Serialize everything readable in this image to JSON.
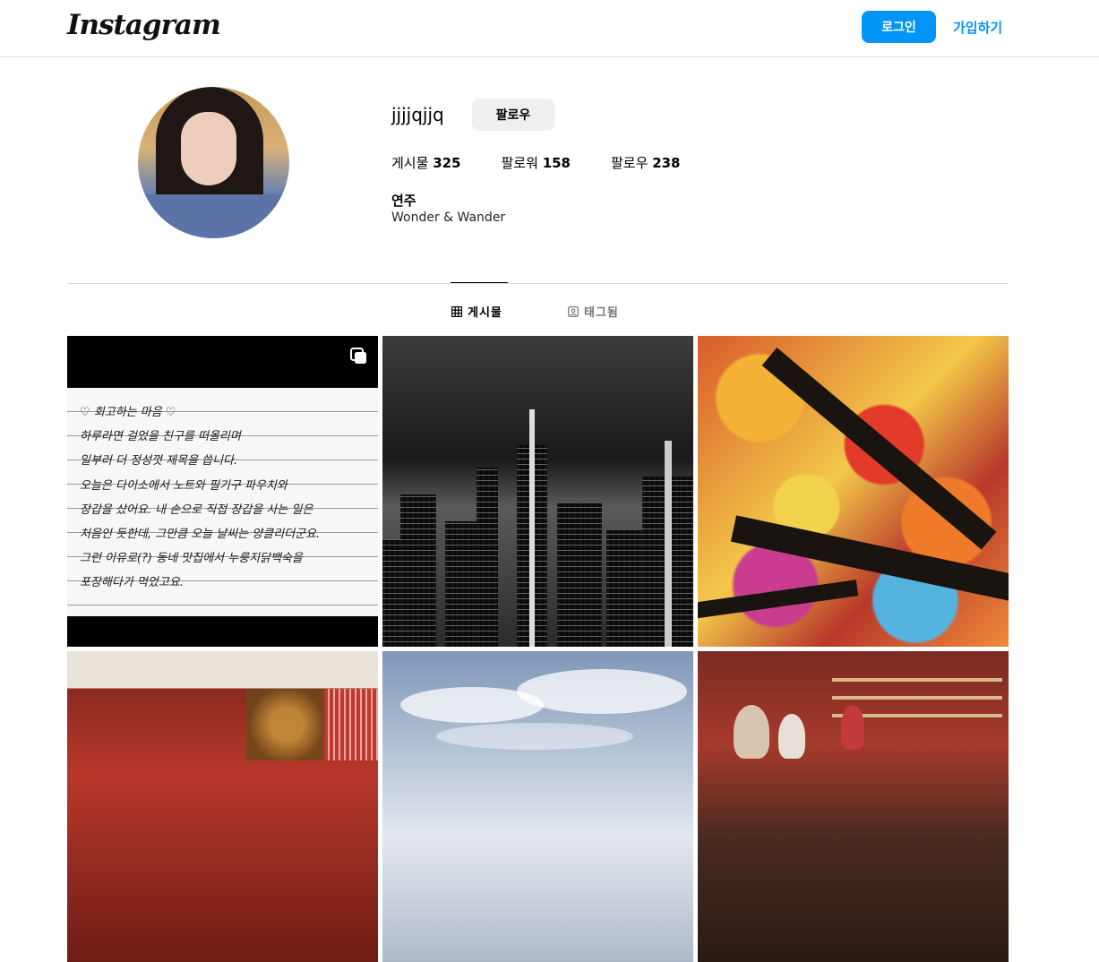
{
  "header": {
    "logo_text": "Instagram",
    "login_label": "로그인",
    "signup_label": "가입하기",
    "accent_color": "#0095f6"
  },
  "profile": {
    "username": "jjjjqjjq",
    "follow_label": "팔로우",
    "stats": [
      {
        "label": "게시물",
        "value": "325"
      },
      {
        "label": "팔로워",
        "value": "158"
      },
      {
        "label": "팔로우",
        "value": "238"
      }
    ],
    "full_name": "연주",
    "bio": "Wonder & Wander"
  },
  "tabs": [
    {
      "label": "게시물",
      "icon": "grid-icon",
      "active": true
    },
    {
      "label": "태그됨",
      "icon": "tagged-icon",
      "active": false
    }
  ],
  "posts": [
    {
      "type": "carousel",
      "note_lines": [
        "♡ 회고하는 마음 ♡",
        "하루라면 걸었을 친구를 떠올리며",
        "일부러 더 정성껏 제목을 씁니다.",
        "오늘은 다이소에서 노트와 필기구 파우치와",
        "장갑을 샀어요.   내 손으로 직접 장갑을 사는 일은",
        "처음인 듯한데,  그만큼 오늘 날씨는 양클리더군요.",
        "그런 이유로(?) 동네 맛집에서  누룽지닭백숙을",
        "포장해다가 먹었고요."
      ]
    },
    {
      "type": "image",
      "icon": "city-skyline-photo"
    },
    {
      "type": "image",
      "icon": "glass-ceiling-photo"
    },
    {
      "type": "image",
      "icon": "red-interior-photo"
    },
    {
      "type": "image",
      "icon": "sky-photo"
    },
    {
      "type": "image",
      "icon": "bar-photo"
    }
  ]
}
